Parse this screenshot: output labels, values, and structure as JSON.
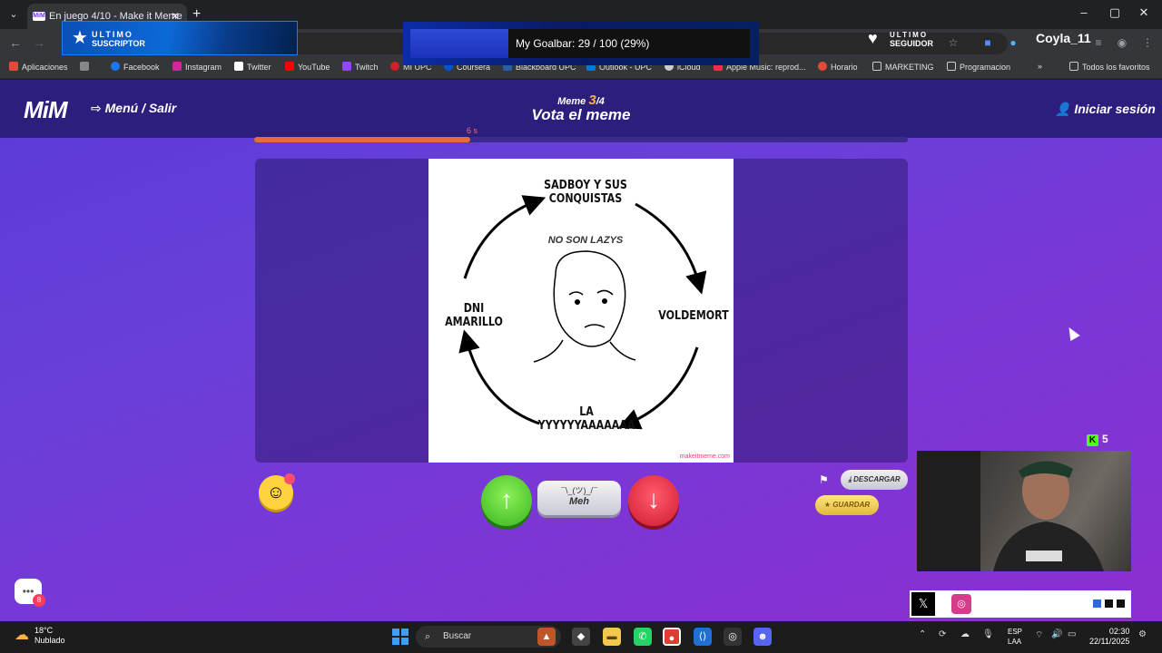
{
  "browser": {
    "tab_title": "En juego 4/10 - Make it Meme",
    "tab_favicon": "MiM",
    "bookmarks": [
      {
        "label": "Aplicaciones",
        "color": "#e34a3b"
      },
      {
        "label": "",
        "color": "#888888"
      },
      {
        "label": "Facebook",
        "color": "#1877f2"
      },
      {
        "label": "Instagram",
        "color": "#d6249f"
      },
      {
        "label": "Twitter",
        "color": "#ffffff"
      },
      {
        "label": "YouTube",
        "color": "#ff0000"
      },
      {
        "label": "Twitch",
        "color": "#9146ff"
      },
      {
        "label": "MI UPC",
        "color": "#d31f26"
      },
      {
        "label": "Coursera",
        "color": "#0056d2"
      },
      {
        "label": "Blackboard UPC",
        "color": "#2b5ea7"
      },
      {
        "label": "Outlook - UPC",
        "color": "#0078d4"
      },
      {
        "label": "iCloud",
        "color": "#cccccc"
      },
      {
        "label": "Apple Music: reprod...",
        "color": "#fa2d48"
      },
      {
        "label": "Horario",
        "color": "#e34a3b"
      },
      {
        "label": "MARKETING",
        "color": "#cccccc"
      },
      {
        "label": "Programacion",
        "color": "#cccccc"
      },
      {
        "label": "Todos los favoritos",
        "color": "#cccccc"
      }
    ]
  },
  "overlays": {
    "sub_line1": "ULTIMO",
    "sub_line2": "SUSCRIPTOR",
    "goal_text": "My Goalbar: 29 / 100 (29%)",
    "goal_progress": 0.29,
    "seg_line1": "ULTIMO",
    "seg_line2": "SEGUIDOR",
    "username": "Coyla_11",
    "kick_count": "5"
  },
  "game": {
    "logo": "MiM",
    "menu": "Menú / Salir",
    "round_label": "Meme",
    "round_current": "3",
    "round_total": "/4",
    "round_title": "Vota el meme",
    "login": "Iniciar sesión",
    "timer_label": "6 s",
    "timer_progress": 0.33,
    "meme": {
      "top": "SADBOY Y SUS\nCONQUISTAS",
      "center_small": "NO SON LAZYS",
      "right": "VOLDEMORT",
      "left": "DNI AMARILLO",
      "bottom": "LA\nYYYYYYAAAAAAA",
      "watermark": "makeitmeme.com"
    },
    "vote_up": "↑",
    "meh_face": "¯\\_(ツ)_/¯",
    "meh_label": "Meh",
    "vote_down": "↓",
    "download": "DESCARGAR",
    "save": "GUARDAR",
    "chat_badge": "8"
  },
  "taskbar": {
    "temp": "18°C",
    "weather": "Nublado",
    "search": "Buscar",
    "lang1": "ESP",
    "lang2": "LAA",
    "time": "02:30",
    "date": "22/11/2025"
  }
}
